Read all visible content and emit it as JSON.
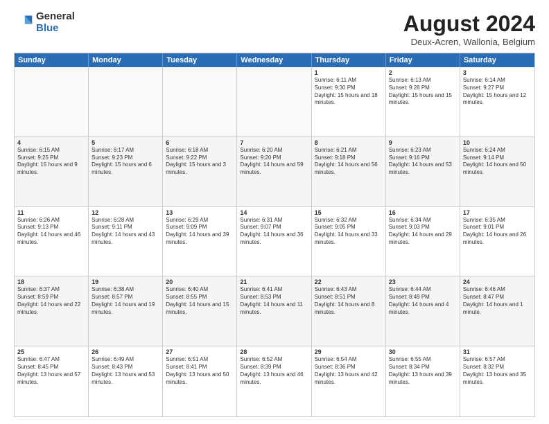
{
  "logo": {
    "general": "General",
    "blue": "Blue"
  },
  "title": "August 2024",
  "location": "Deux-Acren, Wallonia, Belgium",
  "header_days": [
    "Sunday",
    "Monday",
    "Tuesday",
    "Wednesday",
    "Thursday",
    "Friday",
    "Saturday"
  ],
  "weeks": [
    [
      {
        "day": "",
        "text": "",
        "empty": true
      },
      {
        "day": "",
        "text": "",
        "empty": true
      },
      {
        "day": "",
        "text": "",
        "empty": true
      },
      {
        "day": "",
        "text": "",
        "empty": true
      },
      {
        "day": "1",
        "text": "Sunrise: 6:11 AM\nSunset: 9:30 PM\nDaylight: 15 hours and 18 minutes."
      },
      {
        "day": "2",
        "text": "Sunrise: 6:13 AM\nSunset: 9:28 PM\nDaylight: 15 hours and 15 minutes."
      },
      {
        "day": "3",
        "text": "Sunrise: 6:14 AM\nSunset: 9:27 PM\nDaylight: 15 hours and 12 minutes."
      }
    ],
    [
      {
        "day": "4",
        "text": "Sunrise: 6:15 AM\nSunset: 9:25 PM\nDaylight: 15 hours and 9 minutes."
      },
      {
        "day": "5",
        "text": "Sunrise: 6:17 AM\nSunset: 9:23 PM\nDaylight: 15 hours and 6 minutes."
      },
      {
        "day": "6",
        "text": "Sunrise: 6:18 AM\nSunset: 9:22 PM\nDaylight: 15 hours and 3 minutes."
      },
      {
        "day": "7",
        "text": "Sunrise: 6:20 AM\nSunset: 9:20 PM\nDaylight: 14 hours and 59 minutes."
      },
      {
        "day": "8",
        "text": "Sunrise: 6:21 AM\nSunset: 9:18 PM\nDaylight: 14 hours and 56 minutes."
      },
      {
        "day": "9",
        "text": "Sunrise: 6:23 AM\nSunset: 9:16 PM\nDaylight: 14 hours and 53 minutes."
      },
      {
        "day": "10",
        "text": "Sunrise: 6:24 AM\nSunset: 9:14 PM\nDaylight: 14 hours and 50 minutes."
      }
    ],
    [
      {
        "day": "11",
        "text": "Sunrise: 6:26 AM\nSunset: 9:13 PM\nDaylight: 14 hours and 46 minutes."
      },
      {
        "day": "12",
        "text": "Sunrise: 6:28 AM\nSunset: 9:11 PM\nDaylight: 14 hours and 43 minutes."
      },
      {
        "day": "13",
        "text": "Sunrise: 6:29 AM\nSunset: 9:09 PM\nDaylight: 14 hours and 39 minutes."
      },
      {
        "day": "14",
        "text": "Sunrise: 6:31 AM\nSunset: 9:07 PM\nDaylight: 14 hours and 36 minutes."
      },
      {
        "day": "15",
        "text": "Sunrise: 6:32 AM\nSunset: 9:05 PM\nDaylight: 14 hours and 33 minutes."
      },
      {
        "day": "16",
        "text": "Sunrise: 6:34 AM\nSunset: 9:03 PM\nDaylight: 14 hours and 29 minutes."
      },
      {
        "day": "17",
        "text": "Sunrise: 6:35 AM\nSunset: 9:01 PM\nDaylight: 14 hours and 26 minutes."
      }
    ],
    [
      {
        "day": "18",
        "text": "Sunrise: 6:37 AM\nSunset: 8:59 PM\nDaylight: 14 hours and 22 minutes."
      },
      {
        "day": "19",
        "text": "Sunrise: 6:38 AM\nSunset: 8:57 PM\nDaylight: 14 hours and 19 minutes."
      },
      {
        "day": "20",
        "text": "Sunrise: 6:40 AM\nSunset: 8:55 PM\nDaylight: 14 hours and 15 minutes."
      },
      {
        "day": "21",
        "text": "Sunrise: 6:41 AM\nSunset: 8:53 PM\nDaylight: 14 hours and 11 minutes."
      },
      {
        "day": "22",
        "text": "Sunrise: 6:43 AM\nSunset: 8:51 PM\nDaylight: 14 hours and 8 minutes."
      },
      {
        "day": "23",
        "text": "Sunrise: 6:44 AM\nSunset: 8:49 PM\nDaylight: 14 hours and 4 minutes."
      },
      {
        "day": "24",
        "text": "Sunrise: 6:46 AM\nSunset: 8:47 PM\nDaylight: 14 hours and 1 minute."
      }
    ],
    [
      {
        "day": "25",
        "text": "Sunrise: 6:47 AM\nSunset: 8:45 PM\nDaylight: 13 hours and 57 minutes."
      },
      {
        "day": "26",
        "text": "Sunrise: 6:49 AM\nSunset: 8:43 PM\nDaylight: 13 hours and 53 minutes."
      },
      {
        "day": "27",
        "text": "Sunrise: 6:51 AM\nSunset: 8:41 PM\nDaylight: 13 hours and 50 minutes."
      },
      {
        "day": "28",
        "text": "Sunrise: 6:52 AM\nSunset: 8:39 PM\nDaylight: 13 hours and 46 minutes."
      },
      {
        "day": "29",
        "text": "Sunrise: 6:54 AM\nSunset: 8:36 PM\nDaylight: 13 hours and 42 minutes."
      },
      {
        "day": "30",
        "text": "Sunrise: 6:55 AM\nSunset: 8:34 PM\nDaylight: 13 hours and 39 minutes."
      },
      {
        "day": "31",
        "text": "Sunrise: 6:57 AM\nSunset: 8:32 PM\nDaylight: 13 hours and 35 minutes."
      }
    ]
  ]
}
